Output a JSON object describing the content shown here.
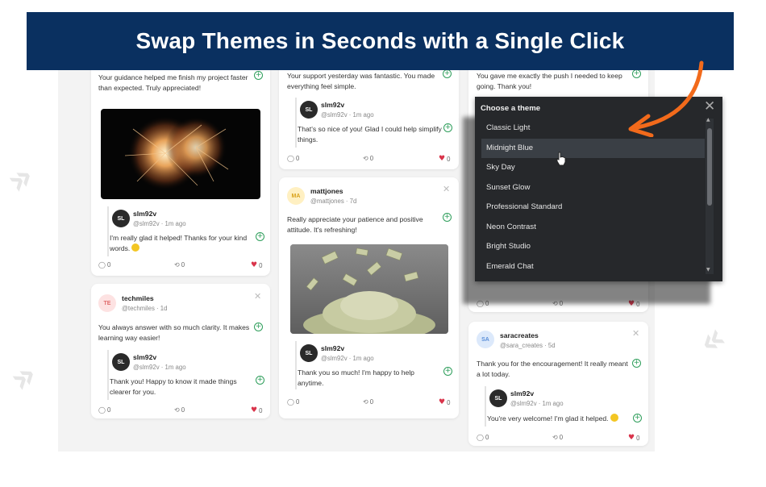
{
  "banner": {
    "title": "Swap Themes in Seconds with a Single Click"
  },
  "col1": {
    "card1": {
      "text": "Your guidance helped me finish my project faster than expected. Truly appreciated!",
      "reply": {
        "avatar": "SL",
        "user": "slm92v",
        "handle": "@slm92v · 1m ago",
        "text": "I'm really glad it helped! Thanks for your kind words."
      },
      "stats": {
        "comments": "0",
        "reposts": "0",
        "likes": "0"
      }
    },
    "card2": {
      "avatar": "TE",
      "user": "techmiles",
      "handle": "@techmiles · 1d",
      "text": "You always answer with so much clarity. It makes learning way easier!",
      "reply": {
        "avatar": "SL",
        "user": "slm92v",
        "handle": "@slm92v · 1m ago",
        "text": "Thank you! Happy to know it made things clearer for you."
      },
      "stats": {
        "comments": "0",
        "reposts": "0",
        "likes": "0"
      }
    }
  },
  "col2": {
    "card1": {
      "text": "Your support yesterday was fantastic. You made everything feel simple.",
      "reply": {
        "avatar": "SL",
        "user": "slm92v",
        "handle": "@slm92v · 1m ago",
        "text": "That's so nice of you! Glad I could help simplify things."
      },
      "stats": {
        "comments": "0",
        "reposts": "0",
        "likes": "0"
      }
    },
    "card2": {
      "avatar": "MA",
      "user": "mattjones",
      "handle": "@mattjones · 7d",
      "text": "Really appreciate your patience and positive attitude. It's refreshing!",
      "reply": {
        "avatar": "SL",
        "user": "slm92v",
        "handle": "@slm92v · 1m ago",
        "text": "Thank you so much! I'm happy to help anytime."
      },
      "stats": {
        "comments": "0",
        "reposts": "0",
        "likes": "0"
      }
    }
  },
  "col3": {
    "card1": {
      "text": "You gave me exactly the push I needed to keep going. Thank you!",
      "stats": {
        "comments": "0",
        "reposts": "0",
        "likes": "0"
      }
    },
    "card2": {
      "avatar": "SA",
      "user": "saracreates",
      "handle": "@sara_creates · 5d",
      "text": "Thank you for the encouragement! It really meant a lot today.",
      "reply": {
        "avatar": "SL",
        "user": "slm92v",
        "handle": "@slm92v · 1m ago",
        "text": "You're very welcome! I'm glad it helped."
      },
      "stats": {
        "comments": "0",
        "reposts": "0",
        "likes": "0"
      }
    }
  },
  "theme_picker": {
    "title": "Choose a theme",
    "options": [
      "Classic Light",
      "Midnight Blue",
      "Sky Day",
      "Sunset Glow",
      "Professional Standard",
      "Neon Contrast",
      "Bright Studio",
      "Emerald Chat"
    ],
    "hovered": "Midnight Blue"
  },
  "colors": {
    "banner": "#0a3060",
    "accent_arrow": "#f26a1b",
    "like": "#d9344b",
    "add": "#2e9e5b",
    "panel": "#26282b"
  }
}
